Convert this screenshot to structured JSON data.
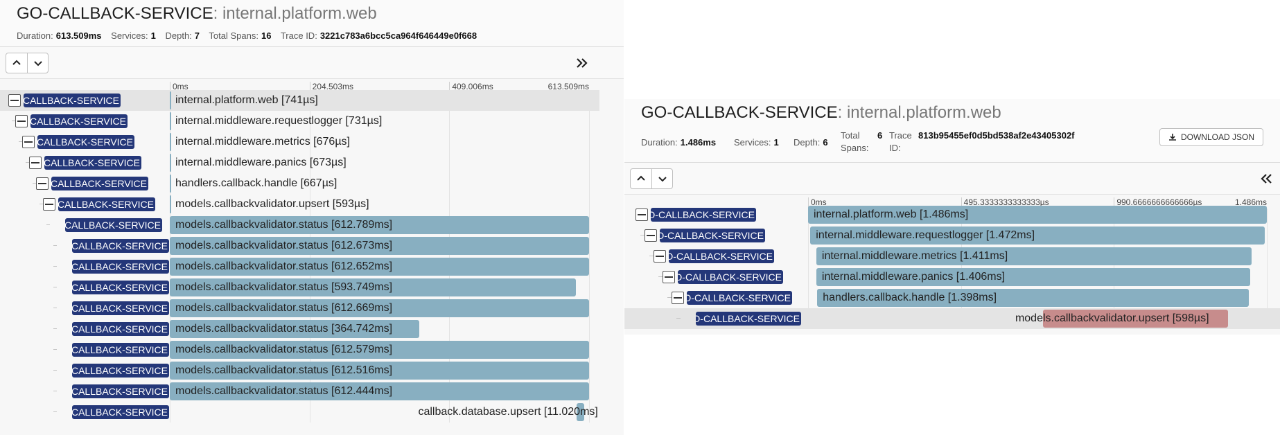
{
  "trace1": {
    "service": "GO-CALLBACK-SERVICE",
    "operation": ": internal.platform.web",
    "meta": [
      {
        "label": "Duration:",
        "value": "613.509ms"
      },
      {
        "label": "Services:",
        "value": "1"
      },
      {
        "label": "Depth:",
        "value": "7"
      },
      {
        "label": "Total Spans:",
        "value": "16"
      },
      {
        "label": "Trace ID:",
        "value": "3221c783a6bcc5ca964f646449e0f668"
      }
    ],
    "ticks": [
      "0ms",
      "204.503ms",
      "409.006ms",
      "613.509ms"
    ],
    "badge": "GO-CALLBACK-SERVICE",
    "spans": [
      {
        "label": "internal.platform.web [741µs]",
        "start": 0,
        "end": 0.001
      },
      {
        "label": "internal.middleware.requestlogger [731µs]",
        "start": 0,
        "end": 0.001
      },
      {
        "label": "internal.middleware.metrics [676µs]",
        "start": 0,
        "end": 0.001
      },
      {
        "label": "internal.middleware.panics [673µs]",
        "start": 0,
        "end": 0.001
      },
      {
        "label": "handlers.callback.handle [667µs]",
        "start": 0,
        "end": 0.001
      },
      {
        "label": "models.callbackvalidator.upsert [593µs]",
        "start": 0,
        "end": 0.001
      },
      {
        "label": "models.callbackvalidator.status [612.789ms]",
        "start": 0,
        "end": 1.0
      },
      {
        "label": "models.callbackvalidator.status [612.673ms]",
        "start": 0,
        "end": 1.0
      },
      {
        "label": "models.callbackvalidator.status [612.652ms]",
        "start": 0,
        "end": 1.0
      },
      {
        "label": "models.callbackvalidator.status [593.749ms]",
        "start": 0,
        "end": 0.969
      },
      {
        "label": "models.callbackvalidator.status [612.669ms]",
        "start": 0,
        "end": 1.0
      },
      {
        "label": "models.callbackvalidator.status [364.742ms]",
        "start": 0,
        "end": 0.595
      },
      {
        "label": "models.callbackvalidator.status [612.579ms]",
        "start": 0,
        "end": 1.0
      },
      {
        "label": "models.callbackvalidator.status [612.516ms]",
        "start": 0,
        "end": 1.0
      },
      {
        "label": "models.callbackvalidator.status [612.444ms]",
        "start": 0,
        "end": 1.0
      },
      {
        "label": "callback.database.upsert [11.020ms]",
        "start": 0.97,
        "end": 0.988
      }
    ]
  },
  "trace2": {
    "service": "GO-CALLBACK-SERVICE",
    "operation": ": internal.platform.web",
    "meta": [
      {
        "label": "Duration:",
        "value": "1.486ms"
      },
      {
        "label": "Services:",
        "value": "1"
      },
      {
        "label": "Depth:",
        "value": "6"
      },
      {
        "label": "Total Spans:",
        "value": "6"
      },
      {
        "label": "Trace ID:",
        "value": "813b95455ef0d5bd538af2e43405302f"
      }
    ],
    "download_label": "DOWNLOAD JSON",
    "ticks": [
      "0ms",
      "495.3333333333333µs",
      "990.6666666666666µs",
      "1.486ms"
    ],
    "badge": "GO-CALLBACK-SERVICE",
    "spans": [
      {
        "label": "internal.platform.web [1.486ms]",
        "start": 0,
        "end": 1.0
      },
      {
        "label": "internal.middleware.requestlogger [1.472ms]",
        "start": 0.005,
        "end": 0.995
      },
      {
        "label": "internal.middleware.metrics [1.411ms]",
        "start": 0.018,
        "end": 0.967
      },
      {
        "label": "internal.middleware.panics [1.406ms]",
        "start": 0.018,
        "end": 0.964
      },
      {
        "label": "handlers.callback.handle [1.398ms]",
        "start": 0.02,
        "end": 0.96
      },
      {
        "label": "models.callbackvalidator.upsert [598µs]",
        "start": 0.512,
        "end": 0.915
      }
    ]
  },
  "colors": {
    "badge": "#243779",
    "bar": "#88afc1",
    "bar_error": "#c78c8c"
  }
}
